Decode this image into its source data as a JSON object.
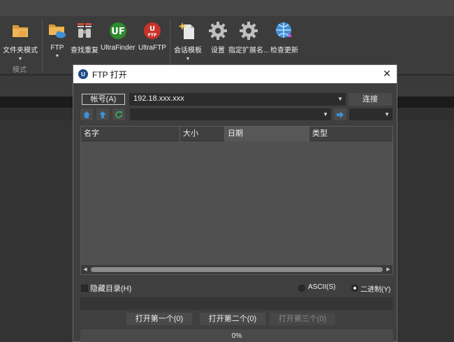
{
  "ribbon": {
    "folder_mode": "文件夹模式",
    "ftp": "FTP",
    "find_dup": "查找重复",
    "ultrafinder": "UltraFinder",
    "ultraftp": "UltraFTP",
    "session_tpl": "会话模板",
    "settings": "设置",
    "assign_ext": "指定扩展名...",
    "check_update": "检查更新",
    "group_mode": "模式"
  },
  "dialog": {
    "title": "FTP 打开",
    "account_label": "帐号(A)",
    "host_value": "192.18.xxx.xxx",
    "connect_label": "连接",
    "path_value": "",
    "columns": [
      "名字",
      "大小",
      "日期",
      "类型"
    ],
    "hidden_dirs_label": "隐藏目录(H)",
    "hidden_dirs_checked": false,
    "ascii_label": "ASCII(S)",
    "binary_label": "二进制(Y)",
    "transfer_mode": "binary",
    "open_first": "打开第一个(0)",
    "open_second": "打开第二个(0)",
    "open_third": "打开第三个(0)",
    "progress_text": "0%",
    "progress_value": 0
  },
  "colors": {
    "ftp_blue": "#1b4c86",
    "ultrafinder_green": "#2e8b2e",
    "ultraftp_red": "#c8322a",
    "nav_blue": "#3d8fd6",
    "refresh_green": "#3aa55a"
  }
}
